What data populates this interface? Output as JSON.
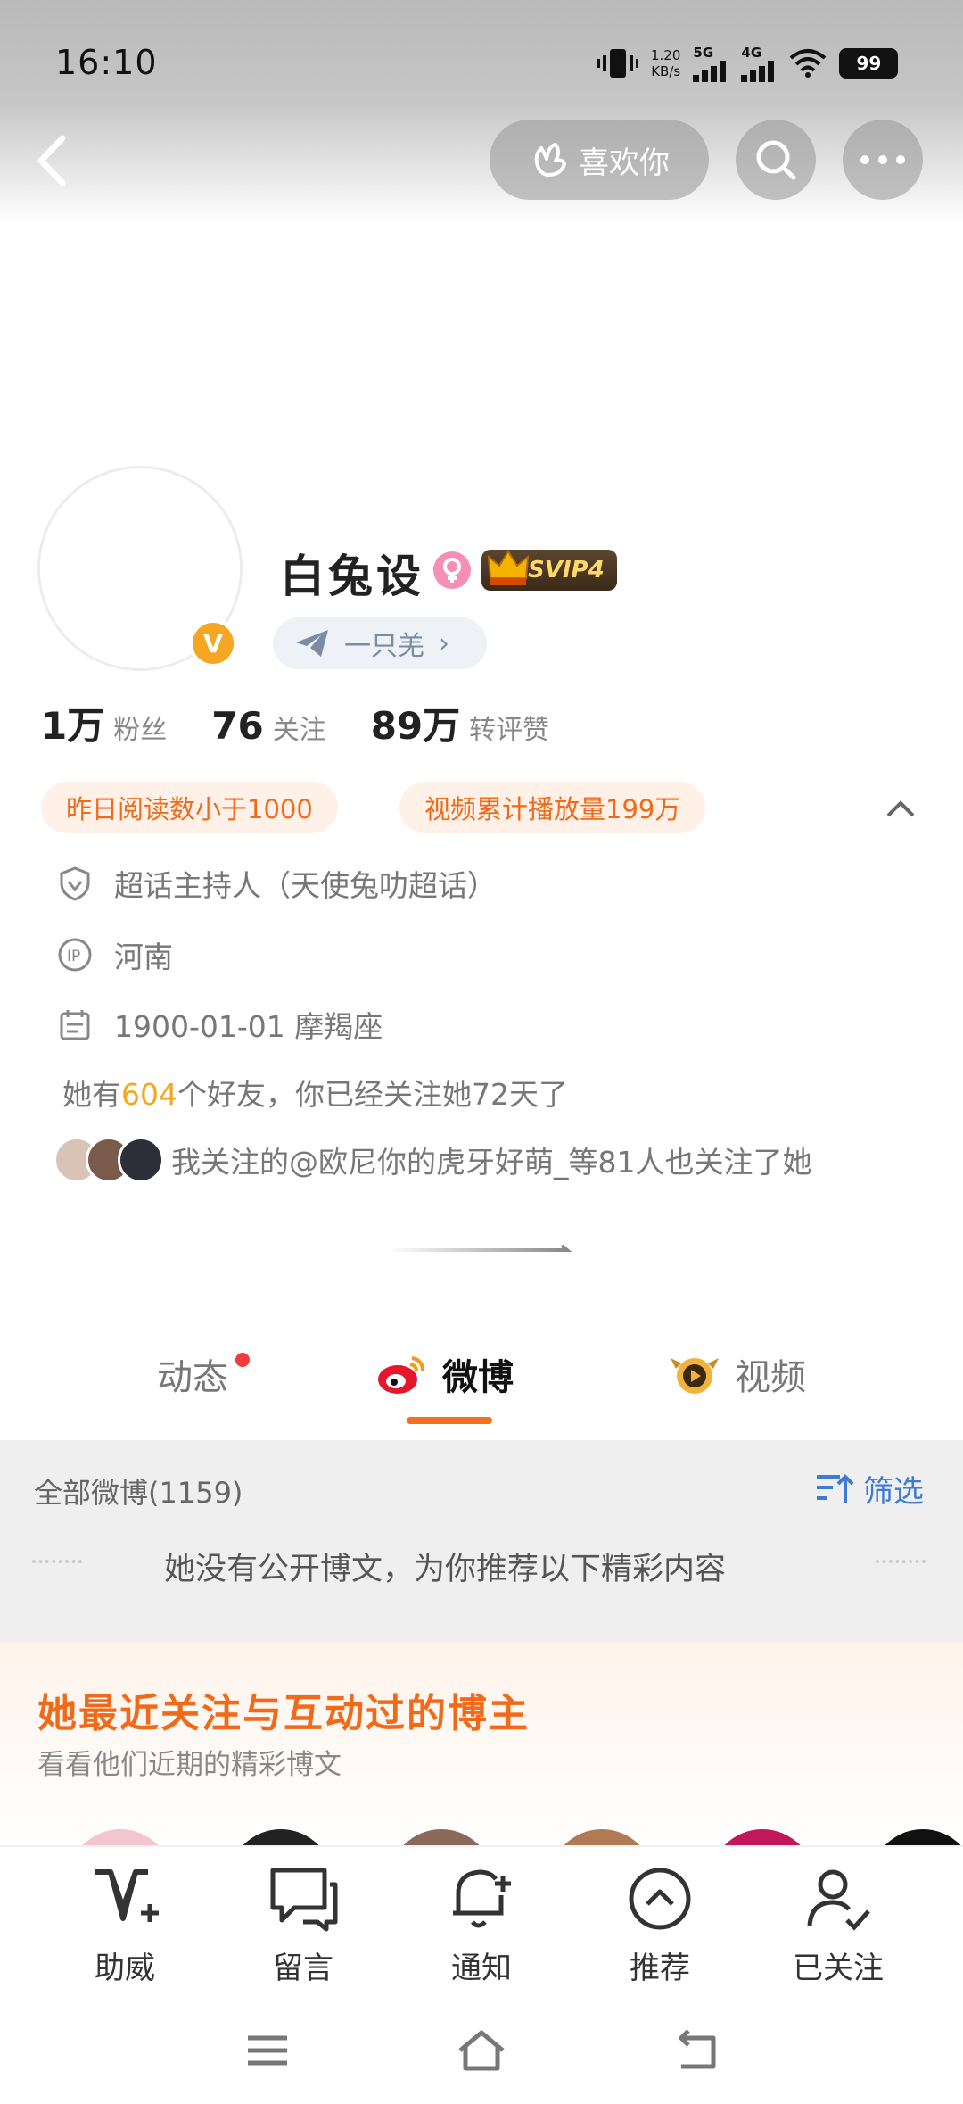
{
  "status_bar": {
    "time": "16:10",
    "net_speed_value": "1.20",
    "net_speed_unit": "KB/s",
    "signal1": "5G",
    "signal2": "4G",
    "battery": "99"
  },
  "header": {
    "like_label": "喜欢你"
  },
  "profile": {
    "name": "白兔设",
    "vip_label": "SVIP4",
    "tagline": "一只羌",
    "stats": [
      {
        "num": "1万",
        "label": "粉丝"
      },
      {
        "num": "76",
        "label": "关注"
      },
      {
        "num": "89万",
        "label": "转评赞"
      }
    ],
    "chips": [
      "昨日阅读数小于1000",
      "视频累计播放量199万"
    ],
    "info": {
      "role": "超话主持人（天使兔叻超话）",
      "ip": "河南",
      "birthday": "1900-01-01 摩羯座",
      "friends_prefix": "她有",
      "friends_count": "604",
      "friends_suffix": "个好友，你已经关注她72天了",
      "mutual": "我关注的@欧尼你的虎牙好萌_等81人也关注了她"
    }
  },
  "tabs": {
    "dynamic": "动态",
    "weibo": "微博",
    "video": "视频"
  },
  "feed": {
    "count_label": "全部微博(1159)",
    "filter_label": "筛选",
    "no_public": "她没有公开博文，为你推荐以下精彩内容"
  },
  "recommend": {
    "title": "她最近关注与互动过的博主",
    "subtitle": "看看他们近期的精彩博文"
  },
  "bottom_nav": [
    {
      "label": "助威"
    },
    {
      "label": "留言"
    },
    {
      "label": "通知"
    },
    {
      "label": "推荐"
    },
    {
      "label": "已关注"
    }
  ],
  "colors": {
    "accent_orange": "#f06a1a",
    "vip_gold": "#ffd86b",
    "verified": "#f5a623",
    "link_blue": "#3d7bd6"
  }
}
